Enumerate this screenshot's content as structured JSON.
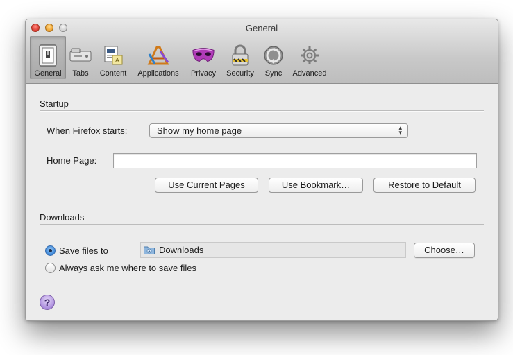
{
  "window": {
    "title": "General"
  },
  "toolbar": {
    "items": [
      {
        "label": "General",
        "icon": "general-switch-icon",
        "selected": true
      },
      {
        "label": "Tabs",
        "icon": "tabs-icon"
      },
      {
        "label": "Content",
        "icon": "content-icon"
      },
      {
        "label": "Applications",
        "icon": "applications-icon"
      },
      {
        "label": "Privacy",
        "icon": "privacy-mask-icon"
      },
      {
        "label": "Security",
        "icon": "security-lock-icon"
      },
      {
        "label": "Sync",
        "icon": "sync-icon"
      },
      {
        "label": "Advanced",
        "icon": "advanced-gear-icon"
      }
    ]
  },
  "startup": {
    "section_title": "Startup",
    "when_starts_label": "When Firefox starts:",
    "when_starts_value": "Show my home page",
    "home_page_label": "Home Page:",
    "home_page_value": "",
    "use_current_pages": "Use Current Pages",
    "use_bookmark": "Use Bookmark…",
    "restore_default": "Restore to Default"
  },
  "downloads": {
    "section_title": "Downloads",
    "save_files_label": "Save files to",
    "save_files_selected": true,
    "folder_name": "Downloads",
    "choose_button": "Choose…",
    "always_ask_label": "Always ask me where to save files",
    "always_ask_selected": false
  },
  "help": {
    "label": "?"
  },
  "colors": {
    "selected_radio": "#3b87d9",
    "help_button": "#b599e2",
    "privacy_mask": "#b03bb8"
  }
}
